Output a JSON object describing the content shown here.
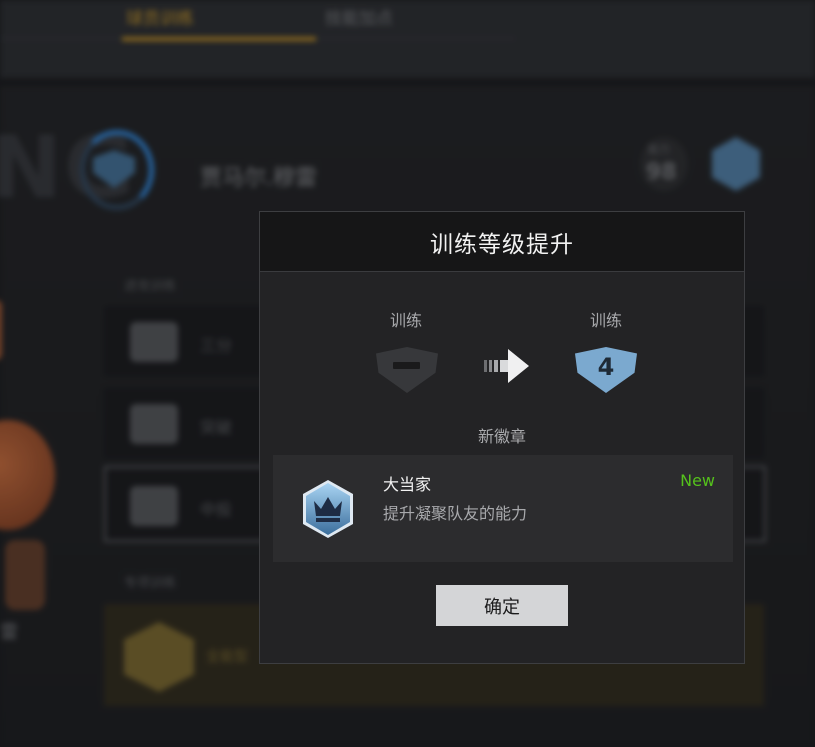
{
  "background": {
    "tabs": [
      {
        "label": "球员训练"
      },
      {
        "label": "技能加点"
      }
    ],
    "big_letters": "NG",
    "player_name": "贾马尔.穆雷",
    "ovr_label": "能力",
    "ovr_value": "98",
    "sections": [
      {
        "label": "进攻训练"
      },
      {
        "label": "专项训练"
      }
    ],
    "rows": [
      {
        "label": "三分"
      },
      {
        "label": "突破"
      },
      {
        "label": "中投"
      }
    ],
    "gold_row_label": "全能型",
    "caption": "雷"
  },
  "modal": {
    "title": "训练等级提升",
    "from_label": "训练",
    "to_label": "训练",
    "from_level": "—",
    "to_level": "4",
    "new_badge_heading": "新徽章",
    "badge": {
      "name": "大当家",
      "description": "提升凝聚队友的能力",
      "tag": "New",
      "icon": "crown-icon"
    },
    "confirm_label": "确定"
  },
  "colors": {
    "accent_gold": "#b08426",
    "badge_blue": "#7ba9cf",
    "new_green": "#55c11c",
    "button_bg": "#d4d5d7"
  }
}
